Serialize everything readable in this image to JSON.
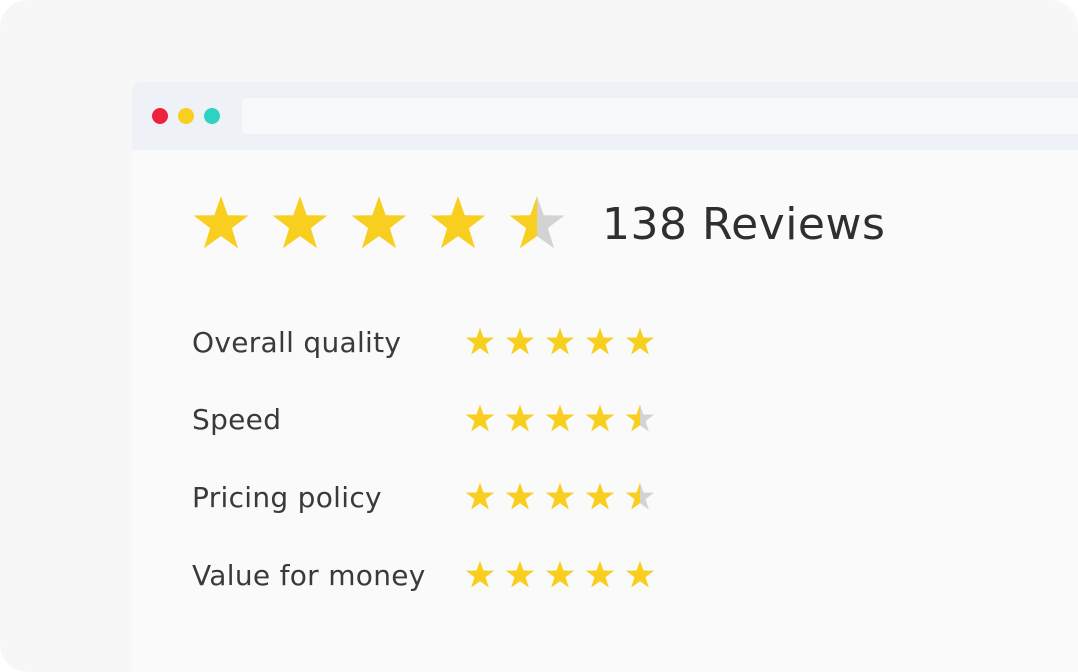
{
  "colors": {
    "star_filled": "#f8cf1f",
    "star_empty": "#d3d3d3",
    "dot_red": "#f0213c",
    "dot_yellow": "#f8cf1f",
    "dot_green": "#2ed3bf"
  },
  "summary": {
    "rating": 4.5,
    "count": "138",
    "count_label": "Reviews"
  },
  "categories": [
    {
      "label": "Overall quality",
      "rating": 5
    },
    {
      "label": "Speed",
      "rating": 4.5
    },
    {
      "label": "Pricing policy",
      "rating": 4.5
    },
    {
      "label": "Value for money",
      "rating": 5
    }
  ]
}
